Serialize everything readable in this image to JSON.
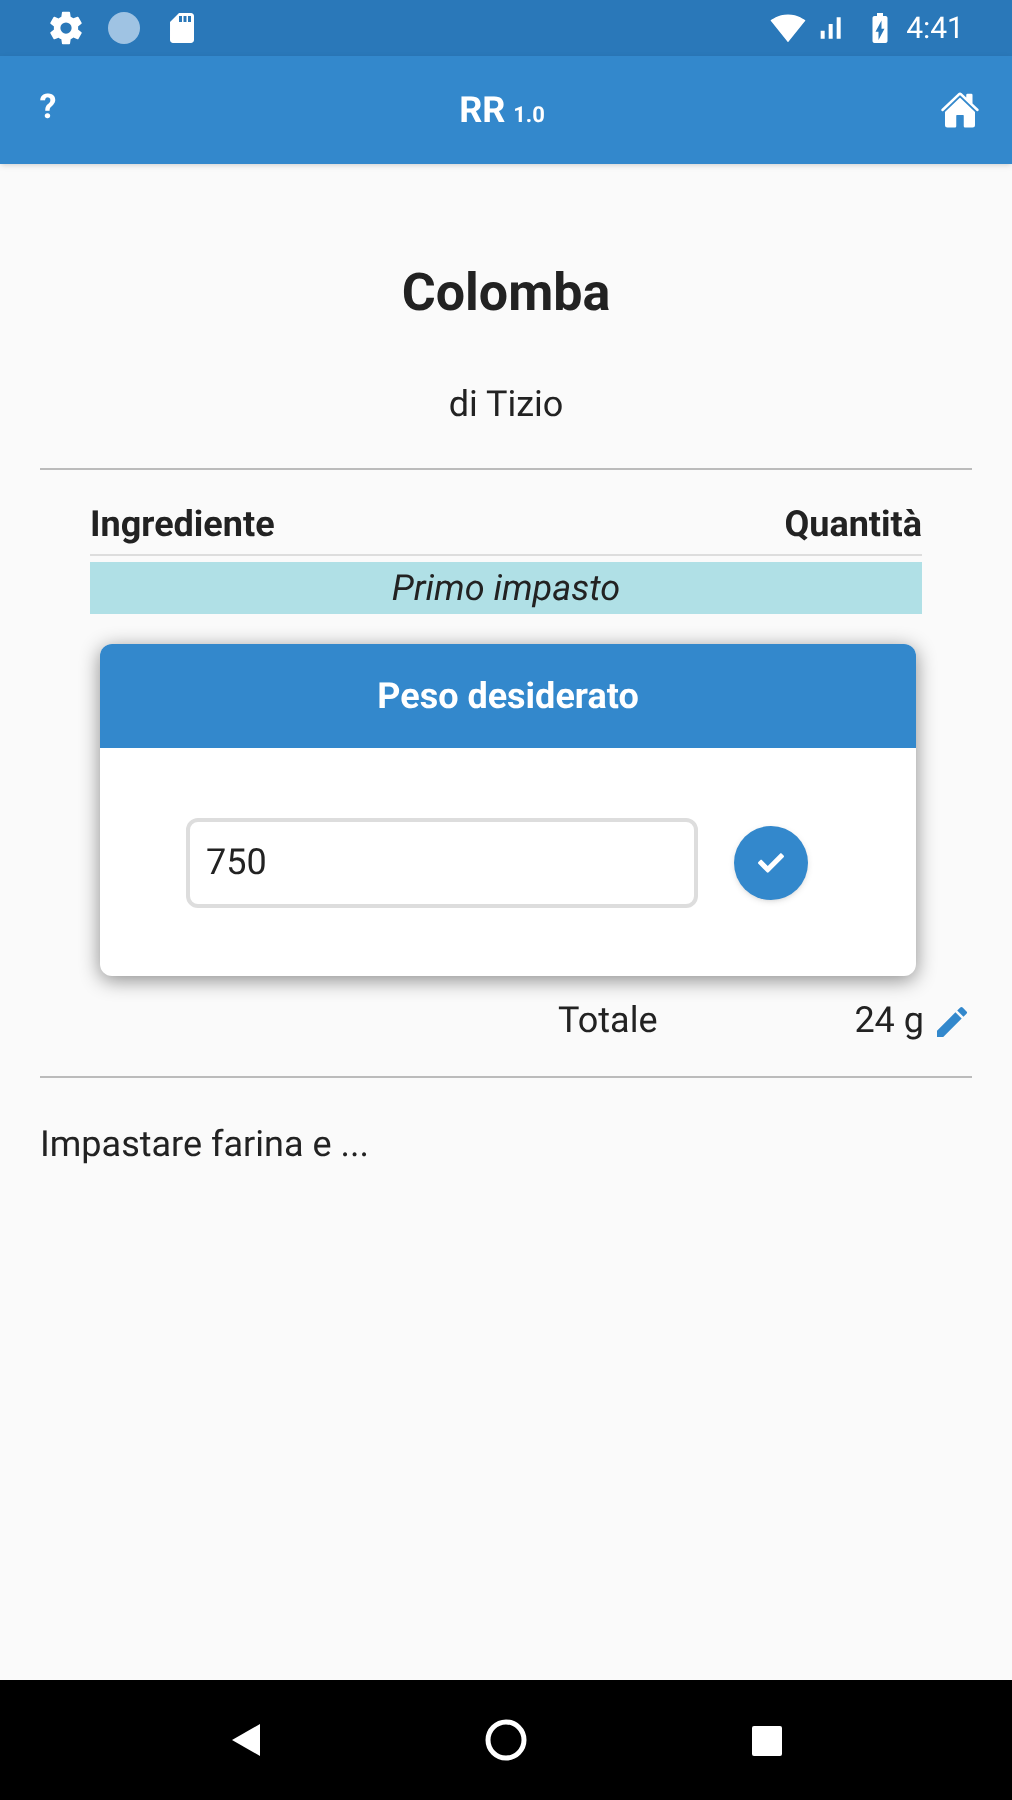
{
  "status_bar": {
    "time": "4:41"
  },
  "app_bar": {
    "help": "?",
    "title": "RR",
    "version": "1.0"
  },
  "recipe": {
    "title": "Colomba",
    "author": "di Tizio"
  },
  "table": {
    "columns": [
      "Ingrediente",
      "Quantità"
    ],
    "sections": [
      {
        "label": "Primo impasto"
      }
    ]
  },
  "total": {
    "label": "Totale",
    "value": "24 g"
  },
  "instructions": "Impastare farina e ...",
  "dialog": {
    "title": "Peso desiderato",
    "value": "750"
  }
}
